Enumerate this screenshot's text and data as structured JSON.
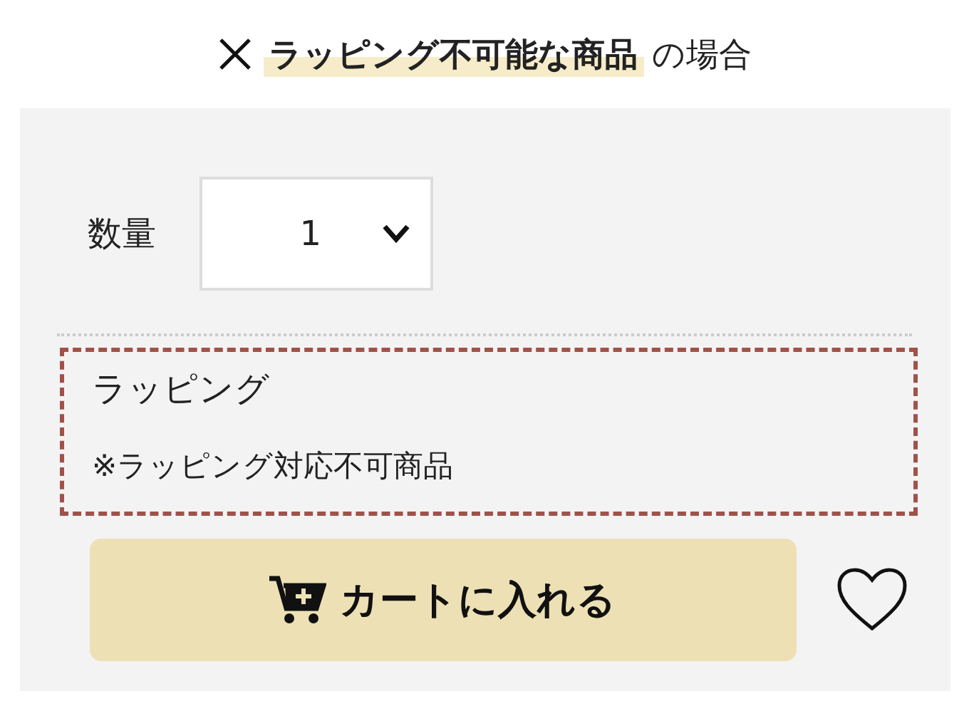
{
  "heading": {
    "highlight": "ラッピング不可能な商品",
    "rest": "の場合"
  },
  "quantity": {
    "label": "数量",
    "value": "1"
  },
  "wrapping": {
    "title": "ラッピング",
    "note": "※ラッピング対応不可商品"
  },
  "cart_button": {
    "label": "カートに入れる"
  }
}
